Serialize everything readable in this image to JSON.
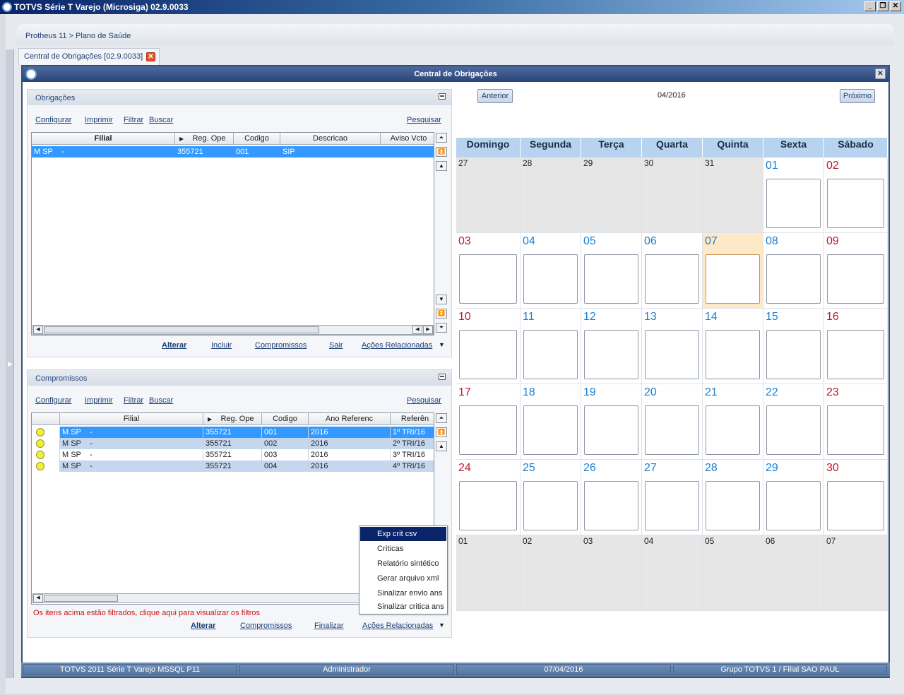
{
  "window": {
    "title": "TOTVS Série T Varejo (Microsiga) 02.9.0033",
    "buttons": [
      "_",
      "❐",
      "✕"
    ]
  },
  "breadcrumb": "Protheus 11 > Plano de Saúde",
  "tab": {
    "label": "Central de Obrigações [02.9.0033]"
  },
  "dialog": {
    "title": "Central de Obrigações"
  },
  "obrigacoes": {
    "title": "Obrigações",
    "toolbar": {
      "configurar": "Configurar",
      "imprimir": "Imprimir",
      "filtrar": "Filtrar",
      "buscar": "Buscar",
      "pesquisar": "Pesquisar"
    },
    "columns": [
      "Filial",
      "Reg. Ope",
      "Codigo",
      "Descricao",
      "Aviso Vcto"
    ],
    "rows": [
      {
        "filial": "M SP",
        "sep": "-",
        "reg": "355721",
        "codigo": "001",
        "descricao": "SIP",
        "aviso": ""
      }
    ],
    "actions": {
      "alterar": "Alterar",
      "incluir": "Incluir",
      "compromissos": "Compromissos",
      "sair": "Sair",
      "acoes": "Ações Relacionadas"
    }
  },
  "compromissos": {
    "title": "Compromissos",
    "toolbar": {
      "configurar": "Configurar",
      "imprimir": "Imprimir",
      "filtrar": "Filtrar",
      "buscar": "Buscar",
      "pesquisar": "Pesquisar"
    },
    "columns": [
      "",
      "Filial",
      "Reg. Ope",
      "Codigo",
      "Ano Referenc",
      "Referên"
    ],
    "rows": [
      {
        "filial": "M SP",
        "sep": "-",
        "reg": "355721",
        "codigo": "001",
        "ano": "2016",
        "ref": "1º TRI/16"
      },
      {
        "filial": "M SP",
        "sep": "-",
        "reg": "355721",
        "codigo": "002",
        "ano": "2016",
        "ref": "2º TRI/16"
      },
      {
        "filial": "M SP",
        "sep": "-",
        "reg": "355721",
        "codigo": "003",
        "ano": "2016",
        "ref": "3º TRI/16"
      },
      {
        "filial": "M SP",
        "sep": "-",
        "reg": "355721",
        "codigo": "004",
        "ano": "2016",
        "ref": "4º TRI/16"
      }
    ],
    "filter_msg": "Os itens acima estão filtrados, clique aqui para visualizar os filtros",
    "actions": {
      "alterar": "Alterar",
      "compromissos": "Compromissos",
      "finalizar": "Finalizar",
      "acoes": "Ações Relacionadas"
    }
  },
  "context_menu": {
    "items": [
      "Exp crit csv",
      "Críticas",
      "Relatório sintético",
      "Gerar arquivo xml",
      "Sinalizar envio ans",
      "Sinalizar critica ans"
    ],
    "highlighted_index": 0
  },
  "calendar": {
    "prev": "Anterior",
    "next": "Próximo",
    "month": "04/2016",
    "weekdays": [
      "Domingo",
      "Segunda",
      "Terça",
      "Quarta",
      "Quinta",
      "Sexta",
      "Sábado"
    ],
    "weeks": [
      [
        "27",
        "28",
        "29",
        "30",
        "31",
        "01",
        "02"
      ],
      [
        "03",
        "04",
        "05",
        "06",
        "07",
        "08",
        "09"
      ],
      [
        "10",
        "11",
        "12",
        "13",
        "14",
        "15",
        "16"
      ],
      [
        "17",
        "18",
        "19",
        "20",
        "21",
        "22",
        "23"
      ],
      [
        "24",
        "25",
        "26",
        "27",
        "28",
        "29",
        "30"
      ],
      [
        "01",
        "02",
        "03",
        "04",
        "05",
        "06",
        "07"
      ]
    ],
    "today": "07"
  },
  "statusbar": {
    "system": "TOTVS 2011 Série T Varejo MSSQL P11",
    "user": "Administrador",
    "date": "07/04/2016",
    "company": "Grupo TOTVS 1 / Filial SAO PAUL"
  },
  "colors": {
    "selected_row": "#3399ff",
    "alt_row": "#c5d7ef",
    "weekend": "#c0182f",
    "weekday": "#1a7fd0",
    "calendar_header": "#b7d3f0"
  }
}
